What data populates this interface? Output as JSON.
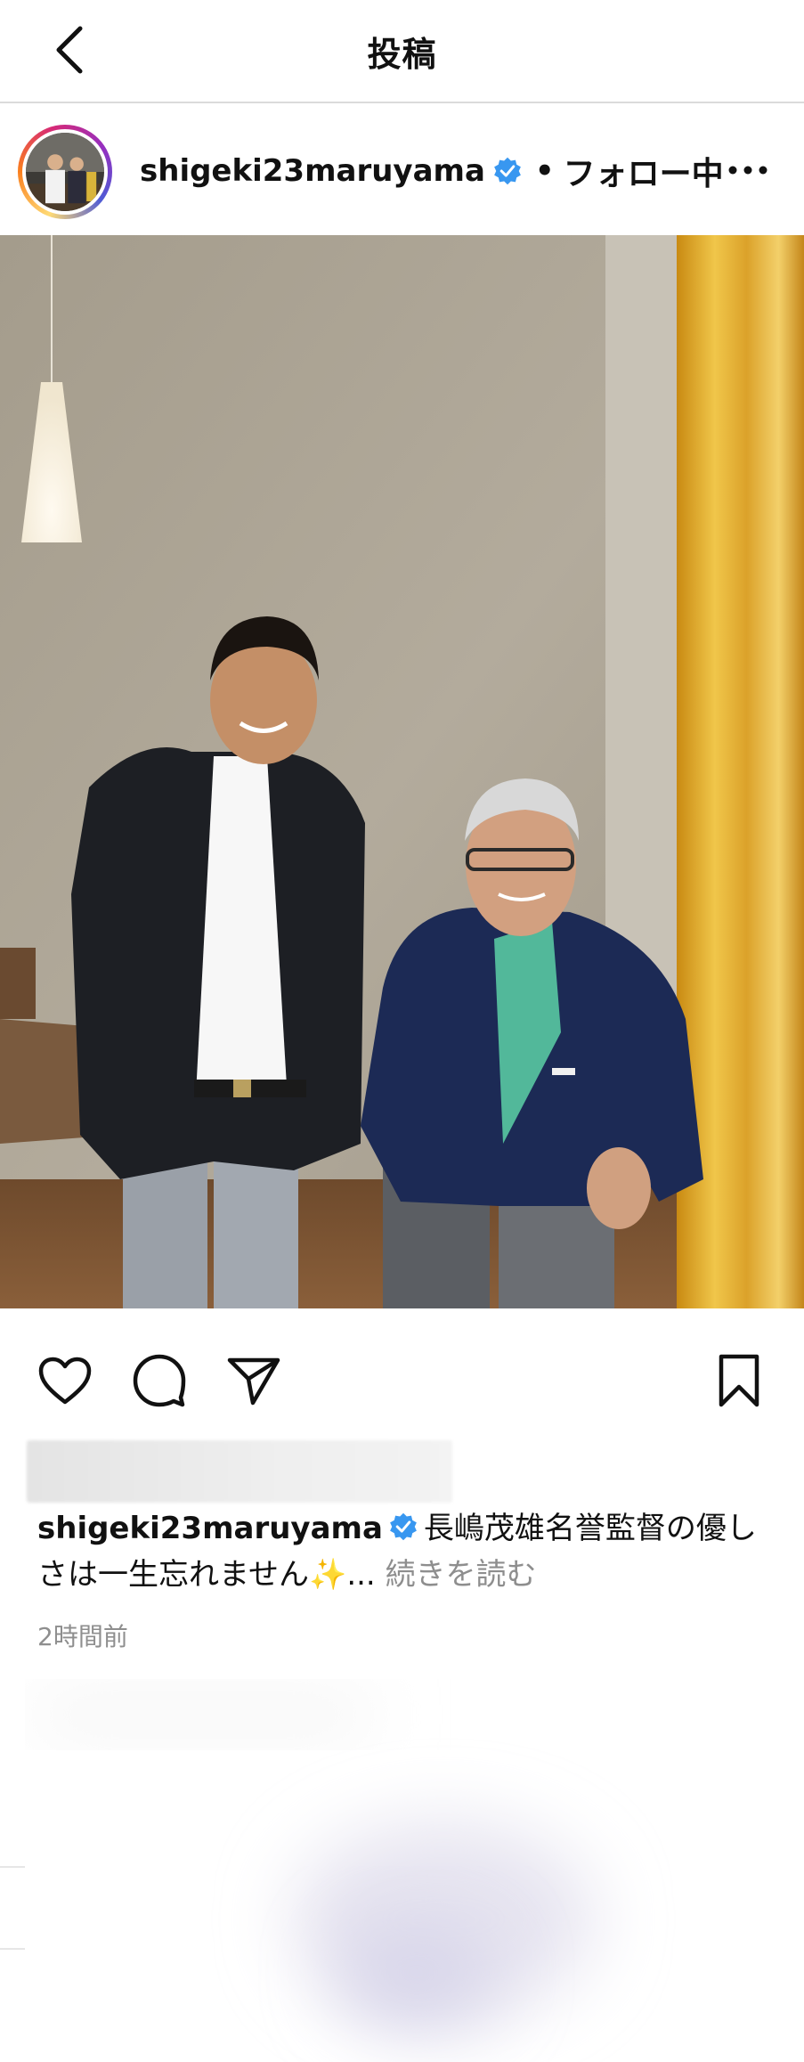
{
  "topbar": {
    "title": "投稿",
    "back_icon": "chevron-left-icon"
  },
  "post": {
    "username": "shigeki23maruyama",
    "verified": true,
    "separator": "•",
    "follow_state": "フォロー中",
    "more_icon": "more-horizontal-icon",
    "photo": "Two men in navy blazers standing side by side in a room with a pendant lamp and yellow curtain"
  },
  "actions": {
    "like_icon": "heart-icon",
    "comment_icon": "comment-icon",
    "share_icon": "send-icon",
    "save_icon": "bookmark-icon"
  },
  "caption": {
    "username": "shigeki23maruyama",
    "text": "長嶋茂雄名誉監督の優しさは一生忘れません✨...",
    "read_more": "続きを読む",
    "timestamp": "2時間前"
  },
  "colors": {
    "verified_blue": "#3897f0",
    "muted_text": "#8e8e8e",
    "divider": "#dbdbdb"
  }
}
